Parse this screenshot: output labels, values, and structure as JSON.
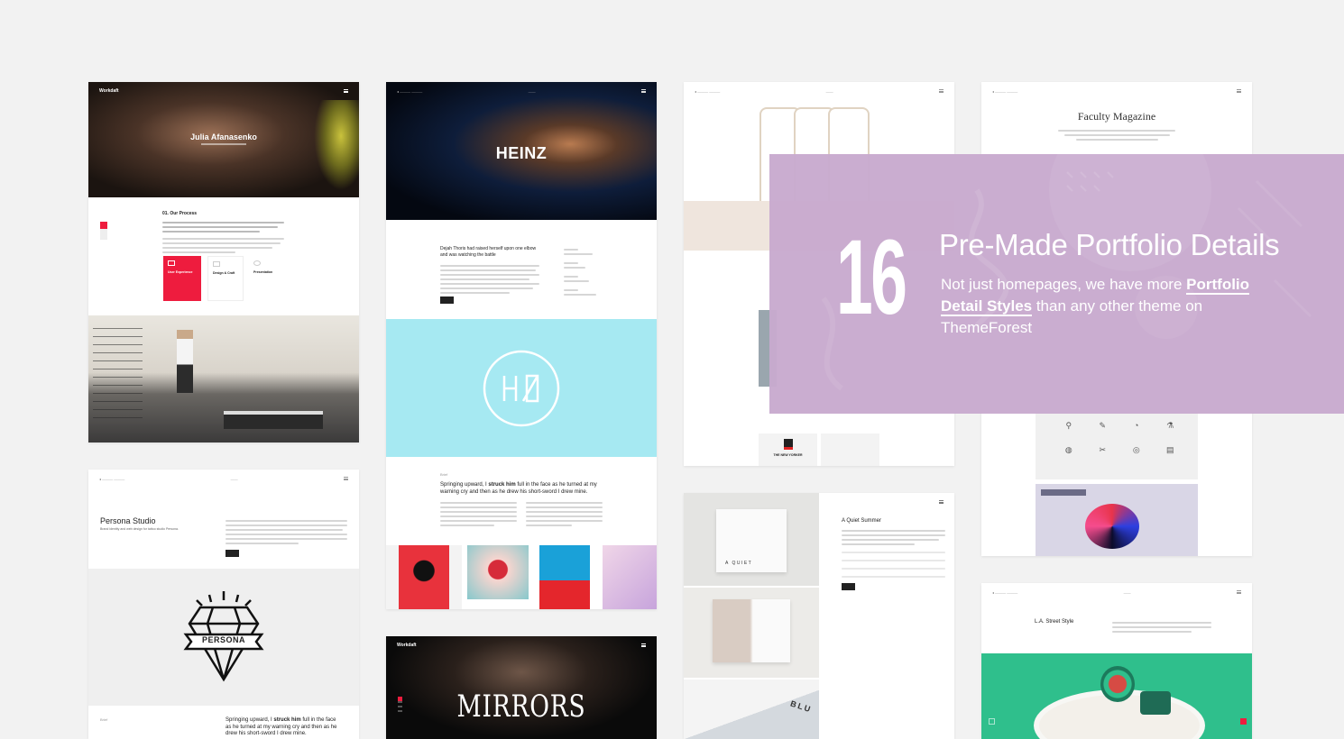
{
  "card1": {
    "logo": "Workdaft",
    "hero_title": "Julia Afanasenko",
    "section_title": "01. Our Process",
    "process_items": [
      "User Experience",
      "Design & Craft",
      "Presentation"
    ]
  },
  "card2": {
    "hero_title": "HEINZ",
    "intro_heading": "Dejah Thoris had raised herself upon one elbow and was watching the battle",
    "brief_label": "Brief",
    "quote_part1": "Springing upward, I ",
    "quote_bold": "struck him",
    "quote_part2": " full in the face as he turned at my warning cry and then as he drew his short-sword I drew mine."
  },
  "card3": {
    "brand_title": "THE NEW YORKER"
  },
  "card4": {
    "title": "Faculty Magazine"
  },
  "card5": {
    "title": "Persona Studio",
    "subtitle": "Brand identity and web design for tattoo studio Persona.",
    "logo_text": "PERSONA",
    "brief_label": "Brief",
    "quote_part1": "Springing upward, I ",
    "quote_bold": "struck him",
    "quote_part2": " full in the face as he turned at my warning cry and then as he drew his short-sword I drew mine."
  },
  "card6": {
    "logo": "Workdaft",
    "hero_title": "MIRRORS"
  },
  "card7": {
    "title": "A Quiet Summer",
    "book1": "A QUIET",
    "book2": "BLU"
  },
  "card8": {
    "title": "L.A. Street Style"
  },
  "overlay": {
    "number": "16",
    "title": "Pre-Made Portfolio Details",
    "sub_part1": "Not just homepages, we have more ",
    "sub_link": "Portfolio Detail Styles",
    "sub_part2": " than any other theme on ThemeForest",
    "bg_color": "#c8aace"
  },
  "colors": {
    "page_bg": "#f2f2f2",
    "accent_red": "#ee1c3e",
    "cyan": "#a6e9f2",
    "green": "#2fbf8c"
  }
}
